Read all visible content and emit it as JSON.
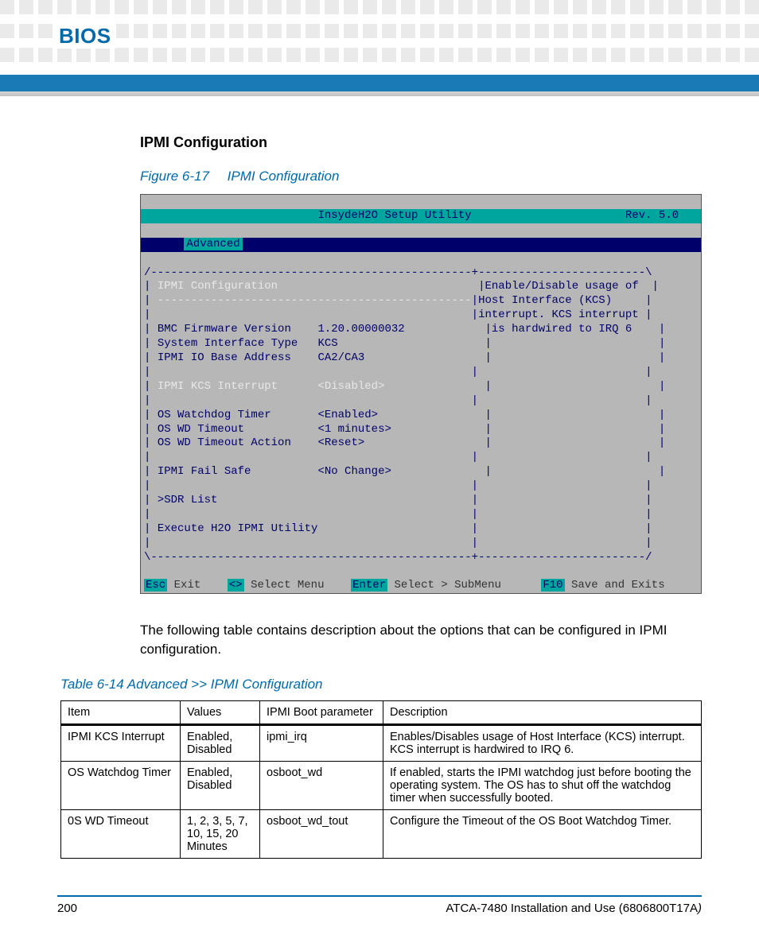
{
  "header": {
    "chapter": "BIOS"
  },
  "section": {
    "title": "IPMI Configuration"
  },
  "figure": {
    "label": "Figure 6-17",
    "title": "IPMI Configuration"
  },
  "bios": {
    "title_left": "InsydeH2O Setup Utility",
    "title_right": "Rev. 5.0",
    "menu_selected": "Advanced",
    "help1": "Enable/Disable usage of",
    "help2": "Host Interface (KCS)",
    "help3": "interrupt. KCS interrupt",
    "help4": "is hardwired to IRQ 6",
    "heading": "IPMI Configuration",
    "rows": {
      "bmc_label": "BMC Firmware Version",
      "bmc_val": "1.20.00000032",
      "sit_label": "System Interface Type",
      "sit_val": "KCS",
      "ioba_label": "IPMI IO Base Address",
      "ioba_val": "CA2/CA3",
      "kcs_label": "IPMI KCS Interrupt",
      "kcs_val": "<Disabled>",
      "oswd_label": "OS Watchdog Timer",
      "oswd_val": "<Enabled>",
      "oswdt_label": "OS WD Timeout",
      "oswdt_val": "<1 minutes>",
      "oswda_label": "OS WD Timeout Action",
      "oswda_val": "<Reset>",
      "fs_label": "IPMI Fail Safe",
      "fs_val": "<No Change>",
      "sdr": ">SDR List",
      "exec": "Execute H2O IPMI Utility"
    },
    "foot": {
      "esc": "Esc",
      "exit": "Exit",
      "arrows": "<>",
      "select_menu": "Select Menu",
      "enter": "Enter",
      "select_sub": "Select > SubMenu",
      "f10": "F10",
      "save": "Save and Exits"
    }
  },
  "body_text": "The following table contains description about the options that can be configured in IPMI configuration.",
  "table": {
    "label": "Table 6-14 Advanced >> IPMI Configuration",
    "headers": [
      "Item",
      "Values",
      "IPMI Boot parameter",
      "Description"
    ],
    "rows": [
      {
        "item": "IPMI KCS Interrupt",
        "values": "Enabled, Disabled",
        "param": "ipmi_irq",
        "desc": "Enables/Disables usage of Host Interface (KCS) interrupt. KCS interrupt is hardwired to IRQ 6."
      },
      {
        "item": "OS Watchdog Timer",
        "values": "Enabled, Disabled",
        "param": "osboot_wd",
        "desc": "If enabled, starts the IPMI watchdog just before booting the operating system. The OS has to shut off the watchdog timer when successfully booted."
      },
      {
        "item": "0S WD Timeout",
        "values": "1, 2, 3, 5, 7, 10, 15, 20 Minutes",
        "param": "osboot_wd_tout",
        "desc": "Configure the Timeout of the OS Boot Watchdog Timer."
      }
    ]
  },
  "footer": {
    "page": "200",
    "doc": "ATCA-7480 Installation and Use (6806800T17A)"
  }
}
